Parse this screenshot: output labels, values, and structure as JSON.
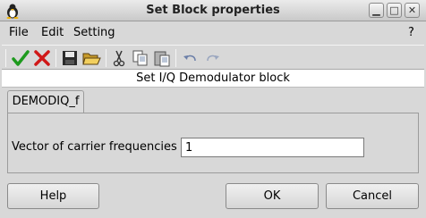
{
  "window": {
    "title": "Set Block properties",
    "controls": {
      "help": "?"
    }
  },
  "menubar": {
    "file": "File",
    "edit": "Edit",
    "setting": "Setting",
    "help": "?"
  },
  "toolbar": {
    "icons": [
      "checkmark-icon",
      "cross-icon",
      "save-icon",
      "open-folder-icon",
      "cut-icon",
      "copy-icon",
      "paste-icon",
      "undo-icon",
      "redo-icon"
    ]
  },
  "block_title": "Set I/Q Demodulator block",
  "tab": {
    "label": "DEMODIQ_f"
  },
  "form": {
    "carrier_label": "Vector of carrier frequencies",
    "carrier_value": "1"
  },
  "buttons": {
    "help": "Help",
    "ok": "OK",
    "cancel": "Cancel"
  },
  "colors": {
    "accept": "#1e9a1e",
    "reject": "#d01818",
    "background": "#d8d8d8"
  }
}
